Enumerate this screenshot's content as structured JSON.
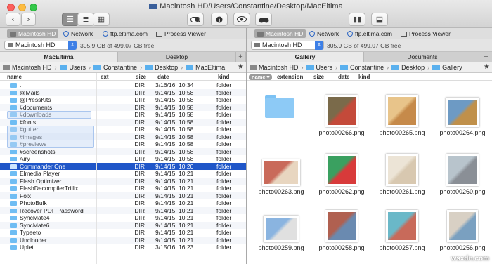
{
  "window": {
    "title": "Macintosh HD/Users/Constantine/Desktop/MacEltima"
  },
  "devices": [
    {
      "label": "Macintosh HD",
      "icon": "drive-icon"
    },
    {
      "label": "Network",
      "icon": "globe-icon"
    },
    {
      "label": "ftp.eltima.com",
      "icon": "globe-icon"
    },
    {
      "label": "Process Viewer",
      "icon": "process-icon"
    }
  ],
  "left": {
    "drive": "Macintosh HD",
    "free": "305.9 GB of 499.07 GB free",
    "tabs": [
      "MacEltima",
      "Desktop"
    ],
    "crumbs": [
      "Macintosh HD",
      "Users",
      "Constantine",
      "Desktop",
      "MacEltima"
    ],
    "columns": {
      "name": "name",
      "ext": "ext",
      "size": "size",
      "date": "date",
      "kind": "kind"
    },
    "rows": [
      {
        "name": "..",
        "size": "DIR",
        "date": "3/16/16, 10:34",
        "kind": "folder"
      },
      {
        "name": "@Mails",
        "size": "DIR",
        "date": "9/14/15, 10:58",
        "kind": "folder"
      },
      {
        "name": "@PressKits",
        "size": "DIR",
        "date": "9/14/15, 10:58",
        "kind": "folder"
      },
      {
        "name": "#documents",
        "size": "DIR",
        "date": "9/14/15, 10:58",
        "kind": "folder"
      },
      {
        "name": "#downloads",
        "size": "DIR",
        "date": "9/14/15, 10:58",
        "kind": "folder"
      },
      {
        "name": "#fonts",
        "size": "DIR",
        "date": "9/14/15, 10:58",
        "kind": "folder"
      },
      {
        "name": "#gutter",
        "size": "DIR",
        "date": "9/14/15, 10:58",
        "kind": "folder"
      },
      {
        "name": "#images",
        "size": "DIR",
        "date": "9/14/15, 10:58",
        "kind": "folder"
      },
      {
        "name": "#previews",
        "size": "DIR",
        "date": "9/14/15, 10:58",
        "kind": "folder"
      },
      {
        "name": "#screenshots",
        "size": "DIR",
        "date": "9/14/15, 10:58",
        "kind": "folder"
      },
      {
        "name": "Airy",
        "size": "DIR",
        "date": "9/14/15, 10:58",
        "kind": "folder"
      },
      {
        "name": "Commander One",
        "size": "DIR",
        "date": "9/14/15, 10:20",
        "kind": "folder"
      },
      {
        "name": "Elmedia Player",
        "size": "DIR",
        "date": "9/14/15, 10:21",
        "kind": "folder"
      },
      {
        "name": "Flash Optimizer",
        "size": "DIR",
        "date": "9/14/15, 10:21",
        "kind": "folder"
      },
      {
        "name": "FlashDecompilerTrillix",
        "size": "DIR",
        "date": "9/14/15, 10:21",
        "kind": "folder"
      },
      {
        "name": "Folx",
        "size": "DIR",
        "date": "9/14/15, 10:21",
        "kind": "folder"
      },
      {
        "name": "PhotoBulk",
        "size": "DIR",
        "date": "9/14/15, 10:21",
        "kind": "folder"
      },
      {
        "name": "Recover PDF Password",
        "size": "DIR",
        "date": "9/14/15, 10:21",
        "kind": "folder"
      },
      {
        "name": "SyncMate4",
        "size": "DIR",
        "date": "9/14/15, 10:21",
        "kind": "folder"
      },
      {
        "name": "SyncMate6",
        "size": "DIR",
        "date": "9/14/15, 10:21",
        "kind": "folder"
      },
      {
        "name": "Typeeto",
        "size": "DIR",
        "date": "9/14/15, 10:21",
        "kind": "folder"
      },
      {
        "name": "Unclouder",
        "size": "DIR",
        "date": "9/14/15, 10:21",
        "kind": "folder"
      },
      {
        "name": "Uplet",
        "size": "DIR",
        "date": "3/15/16, 16:23",
        "kind": "folder"
      }
    ]
  },
  "right": {
    "drive": "Macintosh HD",
    "free": "305.9 GB of 499.07 GB free",
    "tabs": [
      "Gallery",
      "Documents"
    ],
    "crumbs": [
      "Macintosh HD",
      "Users",
      "Constantine",
      "Desktop",
      "Gallery"
    ],
    "columns": {
      "name": "name",
      "extension": "extension",
      "size": "size",
      "date": "date",
      "kind": "kind"
    },
    "items": [
      {
        "caption": "..",
        "colors": [
          "#7cc2f4",
          "#8dcaf6"
        ]
      },
      {
        "caption": "photo00266.png",
        "colors": [
          "#7a6a4a",
          "#c44a3a"
        ]
      },
      {
        "caption": "photo00265.png",
        "colors": [
          "#e8c48a",
          "#c68a4a"
        ]
      },
      {
        "caption": "photo00264.png",
        "colors": [
          "#6d9ac4",
          "#c0904a"
        ]
      },
      {
        "caption": "photo00263.png",
        "colors": [
          "#c96a5a",
          "#e8d6c0"
        ]
      },
      {
        "caption": "photo00262.png",
        "colors": [
          "#3aa060",
          "#d83a3a"
        ]
      },
      {
        "caption": "photo00261.png",
        "colors": [
          "#ece4d6",
          "#d8c8b0"
        ]
      },
      {
        "caption": "photo00260.png",
        "colors": [
          "#b8c4cc",
          "#8a8f96"
        ]
      },
      {
        "caption": "photo00259.png",
        "colors": [
          "#8ab4e0",
          "#e0e0e0"
        ]
      },
      {
        "caption": "photo00258.png",
        "colors": [
          "#b06050",
          "#6a8ab0"
        ]
      },
      {
        "caption": "photo00257.png",
        "colors": [
          "#6ab8c8",
          "#c86a5a"
        ]
      },
      {
        "caption": "photo00256.png",
        "colors": [
          "#d8d0c4",
          "#7aa0c0"
        ]
      }
    ]
  },
  "watermark": "wsxdn.com"
}
